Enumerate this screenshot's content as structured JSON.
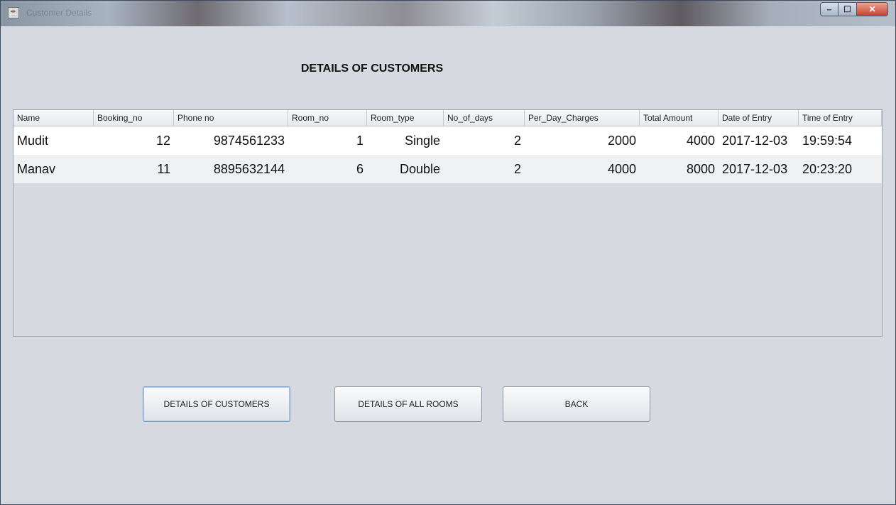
{
  "window": {
    "title": "Customer Details",
    "buttons": [
      "minimize",
      "maximize",
      "close"
    ]
  },
  "heading": "DETAILS OF CUSTOMERS",
  "table": {
    "columns": [
      "Name",
      "Booking_no",
      "Phone no",
      "Room_no",
      "Room_type",
      "No_of_days",
      "Per_Day_Charges",
      "Total Amount",
      "Date of Entry",
      "Time of Entry"
    ],
    "rows": [
      [
        "Mudit",
        "12",
        "9874561233",
        "1",
        "Single",
        "2",
        "2000",
        "4000",
        "2017-12-03",
        "19:59:54"
      ],
      [
        "Manav",
        "11",
        "8895632144",
        "6",
        "Double",
        "2",
        "4000",
        "8000",
        "2017-12-03",
        "20:23:20"
      ]
    ]
  },
  "buttons": {
    "details_customers": "DETAILS OF CUSTOMERS",
    "details_rooms": "DETAILS OF ALL ROOMS",
    "back": "BACK"
  },
  "colors": {
    "background": "#d6d9df",
    "header_bg": "#eef0f3",
    "row_odd": "#ffffff",
    "row_even": "#f0f1f3"
  },
  "icons": {
    "app": "java-app-icon",
    "minimize": "minimize-icon",
    "maximize": "maximize-icon",
    "close": "close-icon"
  }
}
